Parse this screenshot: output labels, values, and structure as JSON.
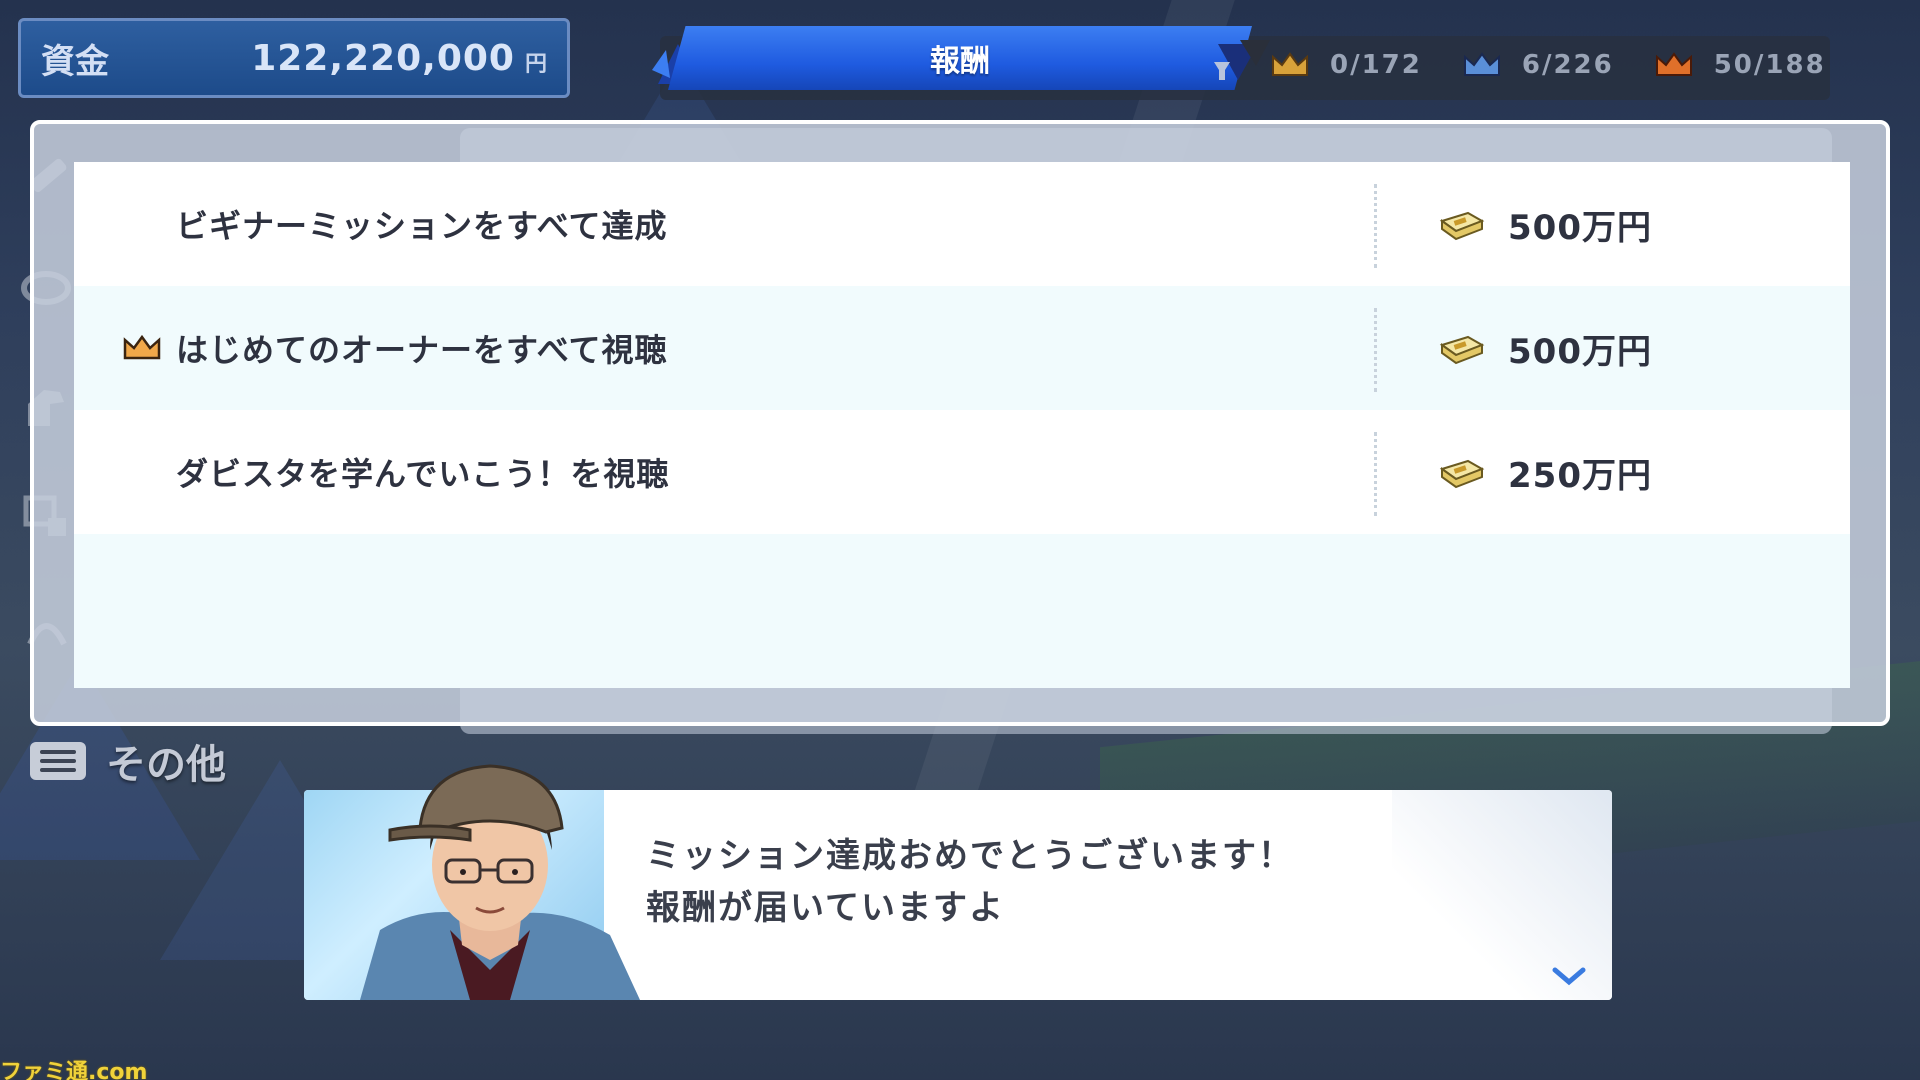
{
  "funds": {
    "label": "資金",
    "amount": "122,220,000",
    "unit": "円"
  },
  "header": {
    "title": "報酬"
  },
  "counters": [
    {
      "icon": "gold-crown-icon",
      "value": "0/172"
    },
    {
      "icon": "blue-crown-icon",
      "value": "6/226"
    },
    {
      "icon": "orange-crown-icon",
      "value": "50/188"
    }
  ],
  "rewards": [
    {
      "crown": false,
      "title": "ビギナーミッションをすべて達成",
      "amount": "500万円"
    },
    {
      "crown": true,
      "title": "はじめてのオーナーをすべて視聴",
      "amount": "500万円"
    },
    {
      "crown": false,
      "title": "ダビスタを学んでいこう！を視聴",
      "amount": "250万円"
    }
  ],
  "side_menu": {
    "other_label": "その他"
  },
  "message": {
    "line1": "ミッション達成おめでとうございます！",
    "line2": "報酬が届いていますよ"
  },
  "watermark": "ファミ通.com",
  "colors": {
    "accent": "#1f5be0",
    "funds_bg": "#1d4b8a",
    "gold": "#d8a23a",
    "blue_crown": "#5a8fd8",
    "orange_crown": "#e0702a"
  }
}
